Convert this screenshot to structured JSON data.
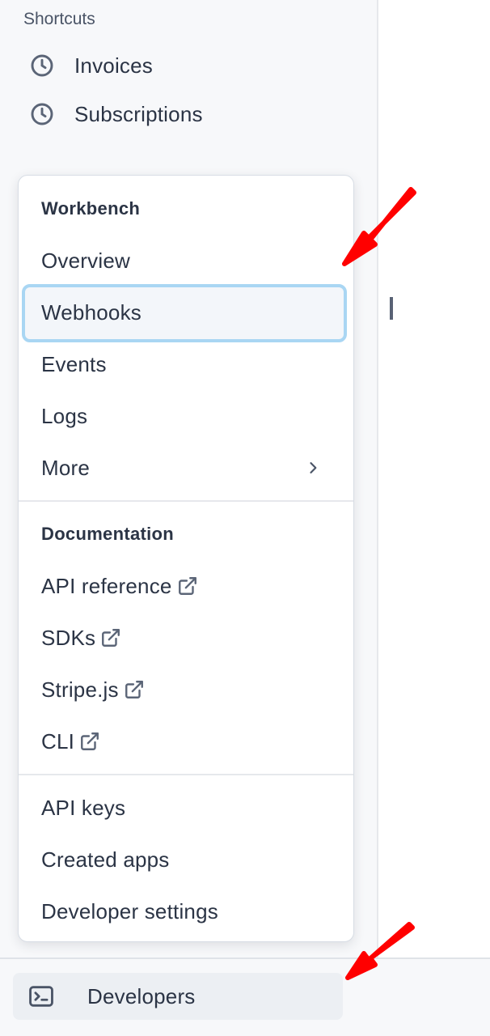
{
  "shortcuts": {
    "title": "Shortcuts",
    "items": [
      {
        "label": "Invoices",
        "icon": "clock-icon"
      },
      {
        "label": "Subscriptions",
        "icon": "clock-icon"
      }
    ]
  },
  "menu": {
    "workbench": {
      "heading": "Workbench",
      "items": [
        {
          "label": "Overview"
        },
        {
          "label": "Webhooks",
          "highlighted": true
        },
        {
          "label": "Events"
        },
        {
          "label": "Logs"
        },
        {
          "label": "More",
          "icon": "chevron-right-icon"
        }
      ]
    },
    "documentation": {
      "heading": "Documentation",
      "items": [
        {
          "label": "API reference",
          "icon": "external-link-icon"
        },
        {
          "label": "SDKs",
          "icon": "external-link-icon"
        },
        {
          "label": "Stripe.js",
          "icon": "external-link-icon"
        },
        {
          "label": "CLI",
          "icon": "external-link-icon"
        }
      ]
    },
    "settings": {
      "items": [
        {
          "label": "API keys"
        },
        {
          "label": "Created apps"
        },
        {
          "label": "Developer settings"
        }
      ]
    }
  },
  "bottom": {
    "developers_label": "Developers",
    "icon": "terminal-icon"
  },
  "colors": {
    "highlight_border": "#a9d6f3",
    "highlight_bg": "#f3f6fa",
    "annotation_arrow": "#ff0000",
    "text": "#2b3445"
  }
}
